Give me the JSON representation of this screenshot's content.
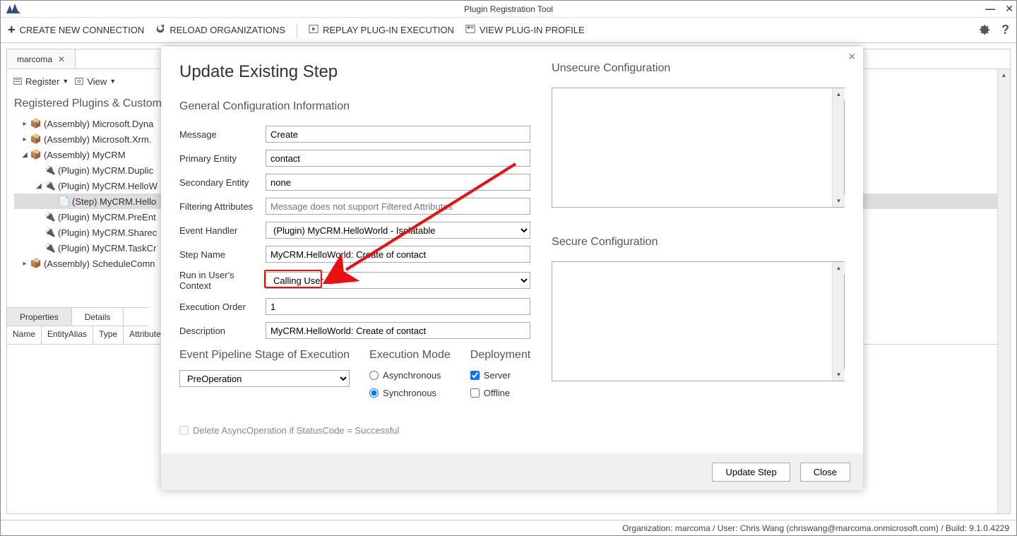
{
  "window": {
    "title": "Plugin Registration Tool"
  },
  "toolbar": {
    "create_connection": "CREATE NEW CONNECTION",
    "reload_orgs": "RELOAD ORGANIZATIONS",
    "replay": "REPLAY PLUG-IN EXECUTION",
    "view_profile": "VIEW PLUG-IN PROFILE"
  },
  "tab": {
    "label": "marcoma"
  },
  "subtoolbar": {
    "register": "Register",
    "view": "View"
  },
  "tree": {
    "title": "Registered Plugins & Custom",
    "items": [
      "(Assembly) Microsoft.Dyna",
      "(Assembly) Microsoft.Xrm.",
      "(Assembly) MyCRM",
      "(Plugin) MyCRM.Duplic",
      "(Plugin) MyCRM.HelloW",
      "(Step) MyCRM.Hello",
      "(Plugin) MyCRM.PreEnt",
      "(Plugin) MyCRM.Sharec",
      "(Plugin) MyCRM.TaskCr",
      "(Assembly) ScheduleComn"
    ]
  },
  "lower_tabs": {
    "properties": "Properties",
    "details": "Details"
  },
  "grid": {
    "name": "Name",
    "entityalias": "EntityAlias",
    "type": "Type",
    "attributes": "Attributes"
  },
  "dialog": {
    "title": "Update Existing Step",
    "general": "General Configuration Information",
    "labels": {
      "message": "Message",
      "primary_entity": "Primary Entity",
      "secondary_entity": "Secondary Entity",
      "filtering": "Filtering Attributes",
      "event_handler": "Event Handler",
      "step_name": "Step Name",
      "run_context": "Run in User's Context",
      "exec_order": "Execution Order",
      "description": "Description"
    },
    "values": {
      "message": "Create",
      "primary_entity": "contact",
      "secondary_entity": "none",
      "filtering_placeholder": "Message does not support Filtered Attributes",
      "event_handler": "(Plugin) MyCRM.HelloWorld - Isolatable",
      "step_name": "MyCRM.HelloWorld: Create of contact",
      "run_context": "Calling User",
      "exec_order": "1",
      "description": "MyCRM.HelloWorld: Create of contact"
    },
    "pipeline": {
      "heading": "Event Pipeline Stage of Execution",
      "value": "PreOperation"
    },
    "exec_mode": {
      "heading": "Execution Mode",
      "async": "Asynchronous",
      "sync": "Synchronous"
    },
    "deployment": {
      "heading": "Deployment",
      "server": "Server",
      "offline": "Offline"
    },
    "delete_async": "Delete AsyncOperation if StatusCode = Successful",
    "unsecure": "Unsecure  Configuration",
    "secure": "Secure  Configuration",
    "update_btn": "Update Step",
    "close_btn": "Close"
  },
  "statusbar": "Organization: marcoma / User: Chris Wang (chriswang@marcoma.onmicrosoft.com) / Build: 9.1.0.4229"
}
